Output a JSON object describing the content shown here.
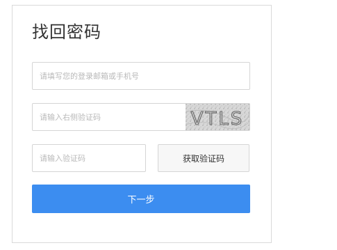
{
  "form": {
    "title": "找回密码",
    "account_placeholder": "请填写您的登录邮箱或手机号",
    "image_captcha_placeholder": "请输入右侧验证码",
    "captcha_text": "VTLS",
    "code_placeholder": "请输入验证码",
    "get_code_label": "获取验证码",
    "next_label": "下一步"
  },
  "colors": {
    "primary": "#3c8df0",
    "border": "#d5d5d5",
    "placeholder": "#b9b9b9"
  }
}
